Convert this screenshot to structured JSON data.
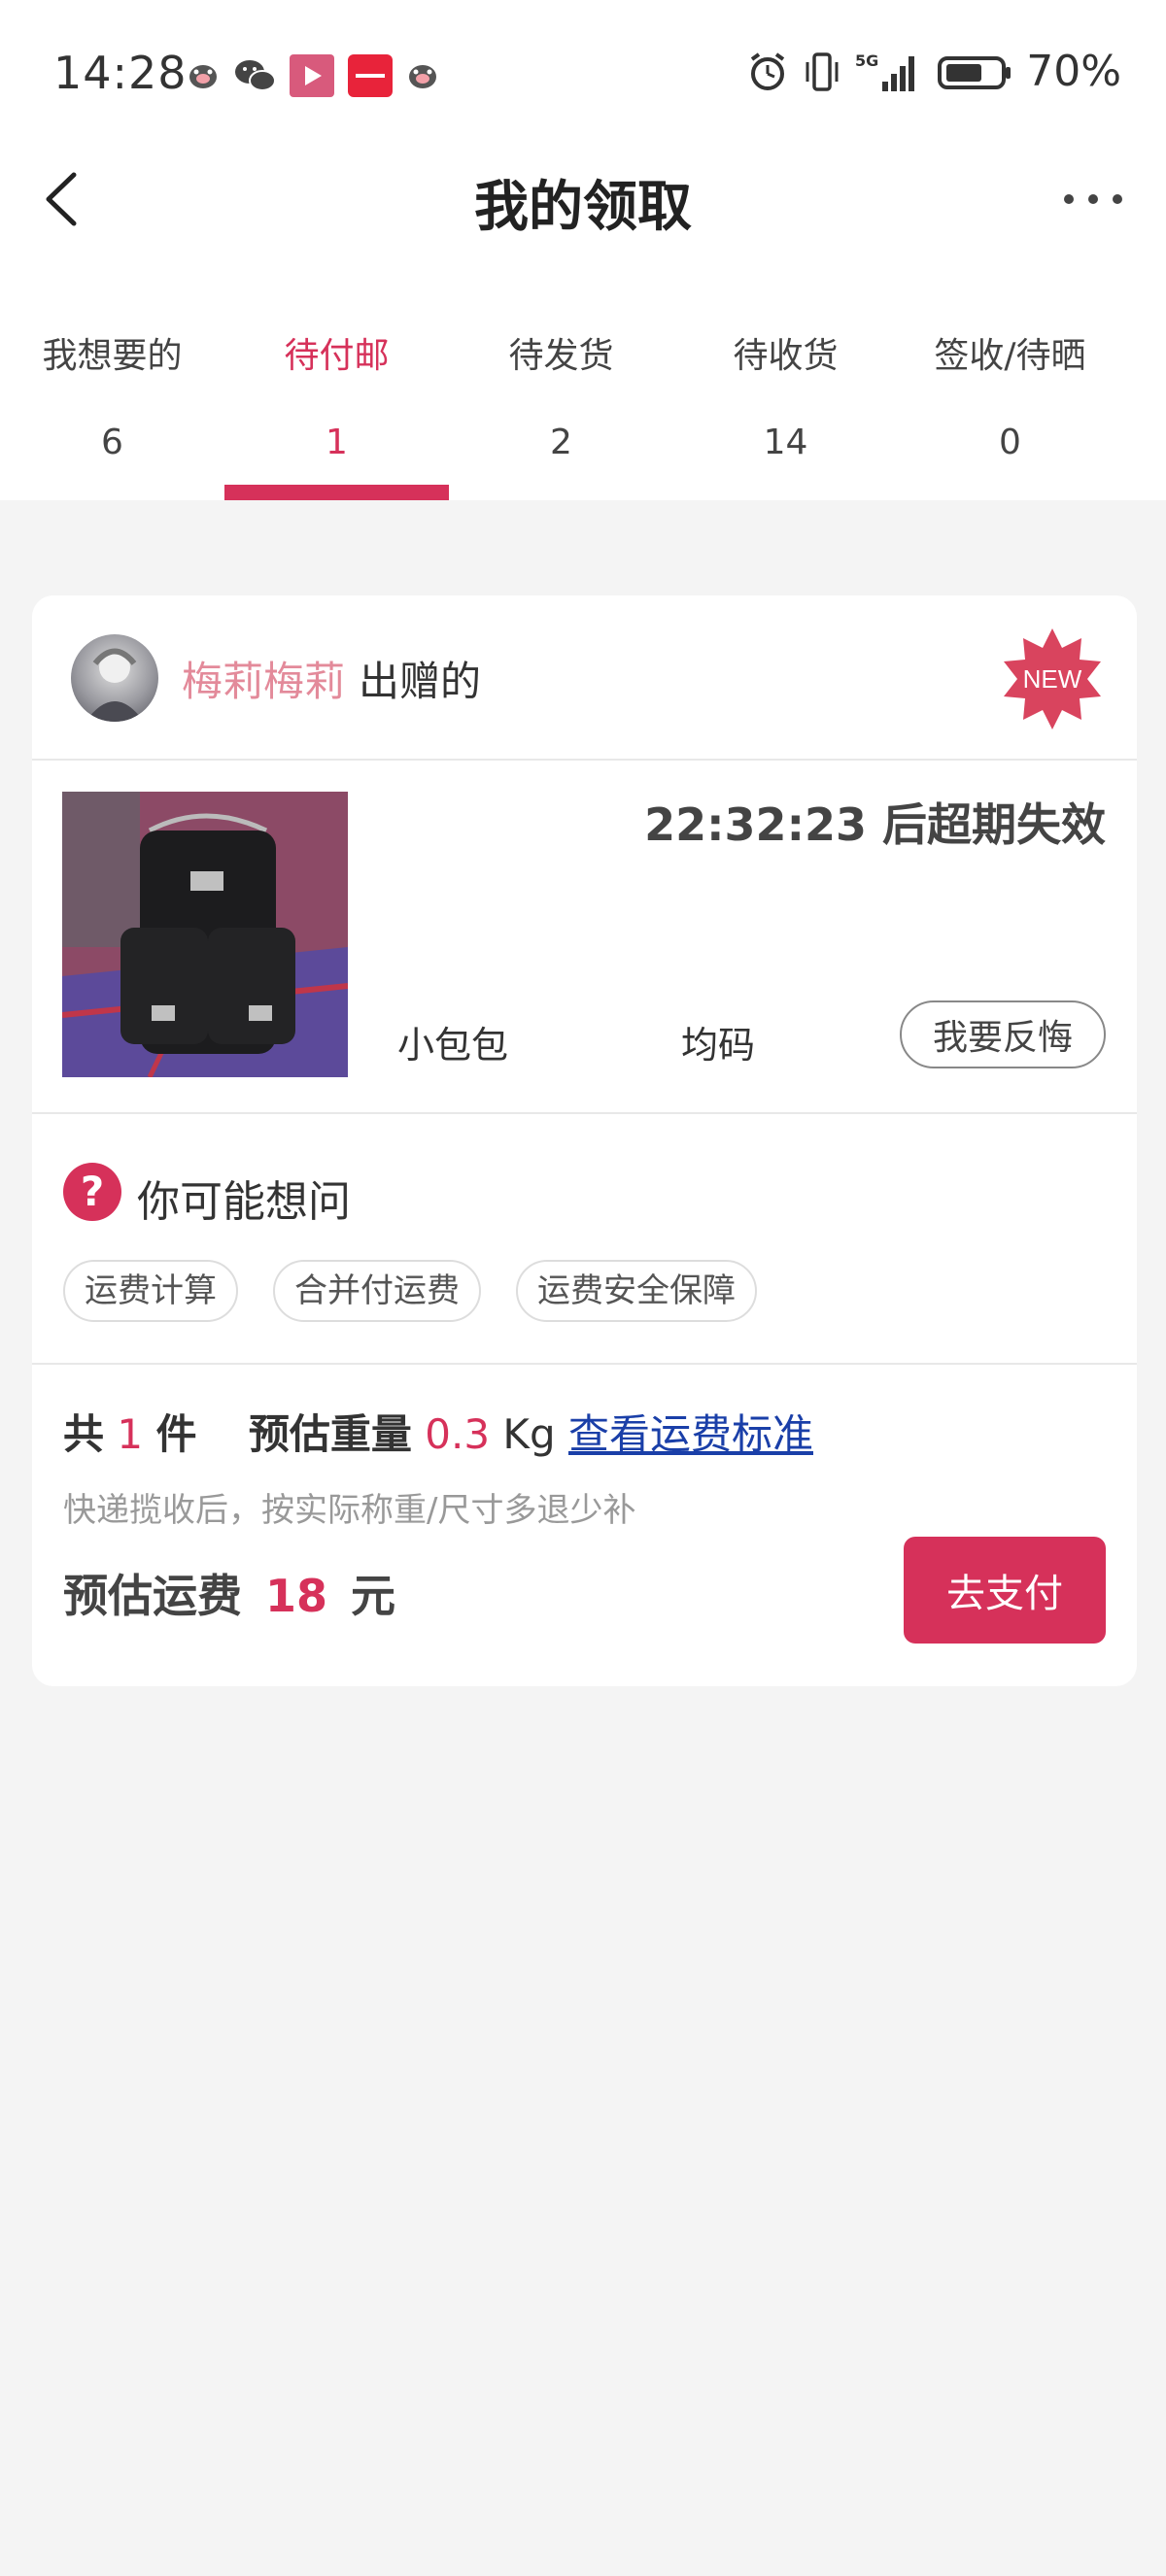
{
  "status_bar": {
    "time": "14:28",
    "network": "5G",
    "battery": "70%",
    "icons_left": [
      "pig-app-icon",
      "wechat-icon",
      "video-app-icon",
      "xiaohongshu-icon",
      "pig-app-icon"
    ],
    "icons_right": [
      "alarm-icon",
      "vibrate-icon",
      "signal-icon",
      "battery-icon"
    ]
  },
  "header": {
    "title": "我的领取"
  },
  "tabs": [
    {
      "label": "我想要的",
      "count": "6"
    },
    {
      "label": "待付邮",
      "count": "1"
    },
    {
      "label": "待发货",
      "count": "2"
    },
    {
      "label": "待收货",
      "count": "14"
    },
    {
      "label": "签收/待晒",
      "count": "0"
    }
  ],
  "card": {
    "giver_name": "梅莉梅莉",
    "giver_suffix": "出赠的",
    "new_badge": "NEW",
    "timer": "22:32:23 后超期失效",
    "item_name": "小包包",
    "item_size": "均码",
    "regret_label": "我要反悔",
    "faq_title": "你可能想问",
    "faq_tags": [
      "运费计算",
      "合并付运费",
      "运费安全保障"
    ],
    "summary": {
      "count_prefix": "共",
      "count": "1",
      "count_suffix": "件",
      "weight_prefix": "预估重量",
      "weight": "0.3",
      "weight_unit": "Kg",
      "standard_link": "查看运费标准",
      "note": "快递揽收后，按实际称重/尺寸多退少补",
      "fee_prefix": "预估运费",
      "fee": "18",
      "fee_unit": "元"
    },
    "pay_label": "去支付"
  },
  "colors": {
    "accent": "#d6315a",
    "giver_name": "#e38a9a",
    "link": "#1a3fa8"
  }
}
